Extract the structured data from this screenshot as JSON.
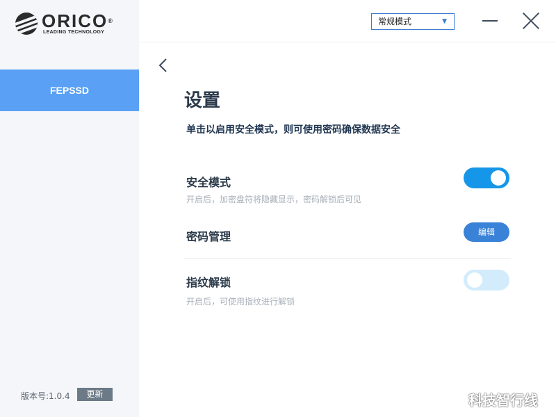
{
  "brand": {
    "name": "ORICO",
    "registered": "®",
    "tagline": "LEADING TECHNOLOGY"
  },
  "sidebar": {
    "devices": [
      {
        "label": "FEPSSD",
        "selected": true
      }
    ],
    "version_text": "版本号:1.0.4",
    "update_label": "更新"
  },
  "header": {
    "mode_select": {
      "value": "常规模式",
      "caret": "▼"
    },
    "minimize_icon": "minimize-icon",
    "close_icon": "close-icon"
  },
  "main": {
    "back_icon": "chevron-left-icon",
    "title": "设置",
    "subtitle": "单击以启用安全模式，则可使用密码确保数据安全",
    "settings": {
      "security_mode": {
        "label": "安全模式",
        "desc": "开启后，加密盘符将隐藏显示，密码解锁后可见",
        "enabled": true
      },
      "password": {
        "label": "密码管理",
        "button_label": "编辑"
      },
      "fingerprint": {
        "label": "指纹解锁",
        "desc": "开启后，可使用指纹进行解锁",
        "enabled": false
      }
    }
  },
  "watermark": "科技智行线",
  "colors": {
    "accent": "#5aa0f5",
    "toggle_on": "#1696e8",
    "toggle_off": "#d3ecfb",
    "edit_button": "#3a82d8",
    "sidebar_bg": "#f4f6f9"
  }
}
